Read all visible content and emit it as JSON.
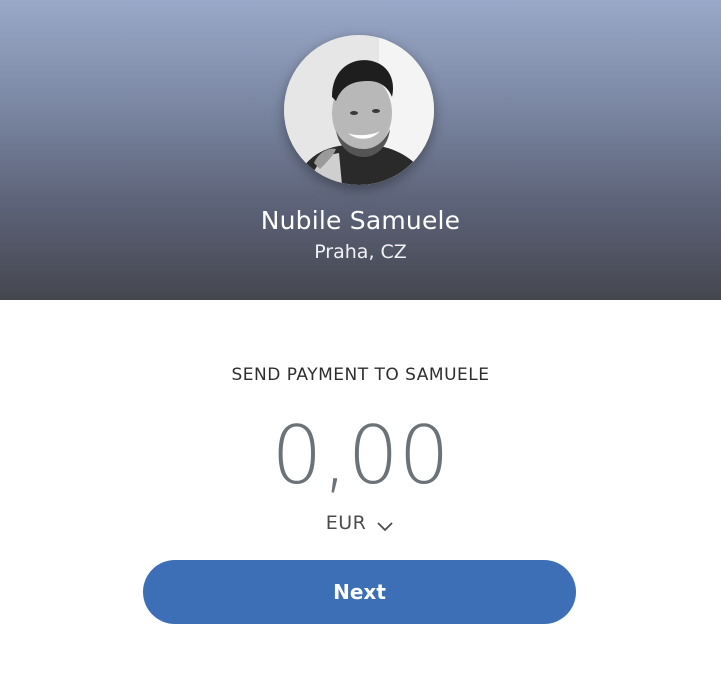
{
  "profile": {
    "name": "Nubile Samuele",
    "location": "Praha, CZ"
  },
  "payment": {
    "label": "SEND PAYMENT TO SAMUELE",
    "amount": "0,00",
    "currency": "EUR"
  },
  "actions": {
    "next_label": "Next"
  },
  "colors": {
    "header_top": "#9aa9c9",
    "header_bottom": "#45474f",
    "button": "#3d6fb6",
    "amount_text": "#6c7378"
  },
  "icons": {
    "currency_dropdown": "chevron-down-icon",
    "avatar": "avatar"
  }
}
